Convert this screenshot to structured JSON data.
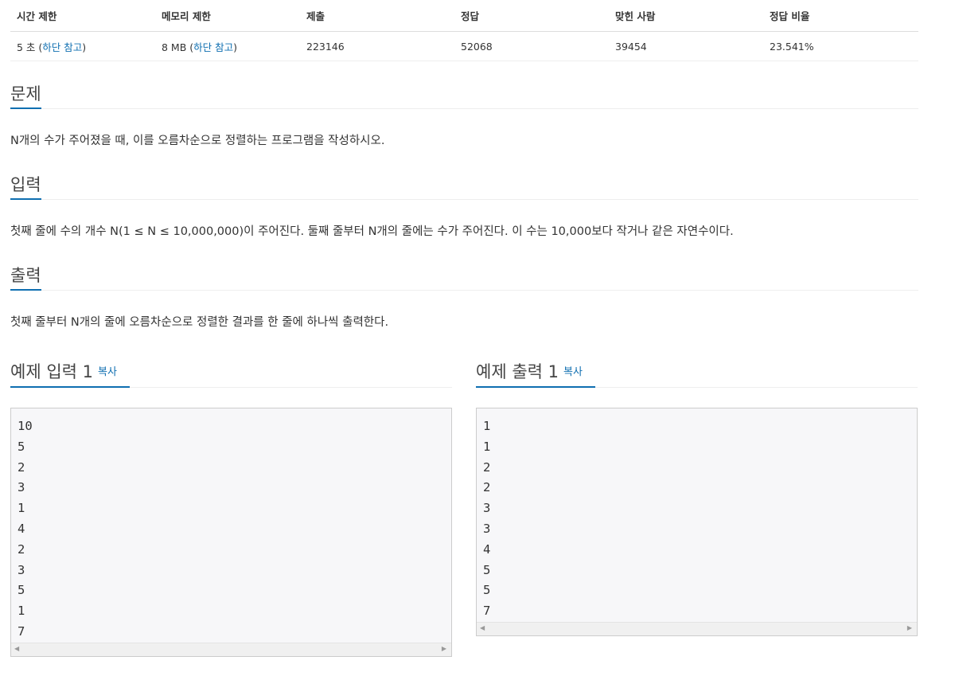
{
  "info": {
    "headers": [
      "시간 제한",
      "메모리 제한",
      "제출",
      "정답",
      "맞힌 사람",
      "정답 비율"
    ],
    "time_limit": {
      "value": "5 초",
      "note": "하단 참고"
    },
    "memory_limit": {
      "value": "8 MB",
      "note": "하단 참고"
    },
    "submissions": "223146",
    "correct": "52068",
    "solved_users": "39454",
    "ratio": "23.541%"
  },
  "problem": {
    "title": "문제",
    "text": "N개의 수가 주어졌을 때, 이를 오름차순으로 정렬하는 프로그램을 작성하시오."
  },
  "input": {
    "title": "입력",
    "text": "첫째 줄에 수의 개수 N(1 ≤ N ≤ 10,000,000)이 주어진다. 둘째 줄부터 N개의 줄에는 수가 주어진다. 이 수는 10,000보다 작거나 같은 자연수이다."
  },
  "output": {
    "title": "출력",
    "text": "첫째 줄부터 N개의 줄에 오름차순으로 정렬한 결과를 한 줄에 하나씩 출력한다."
  },
  "sample_input": {
    "title": "예제 입력 1",
    "copy_label": "복사",
    "lines": [
      "10",
      "5",
      "2",
      "3",
      "1",
      "4",
      "2",
      "3",
      "5",
      "1",
      "7"
    ]
  },
  "sample_output": {
    "title": "예제 출력 1",
    "copy_label": "복사",
    "lines": [
      "1",
      "1",
      "2",
      "2",
      "3",
      "3",
      "4",
      "5",
      "5",
      "7"
    ]
  },
  "colors": {
    "link": "#0f6fb1",
    "accent_underline": "#0f6fb1"
  }
}
